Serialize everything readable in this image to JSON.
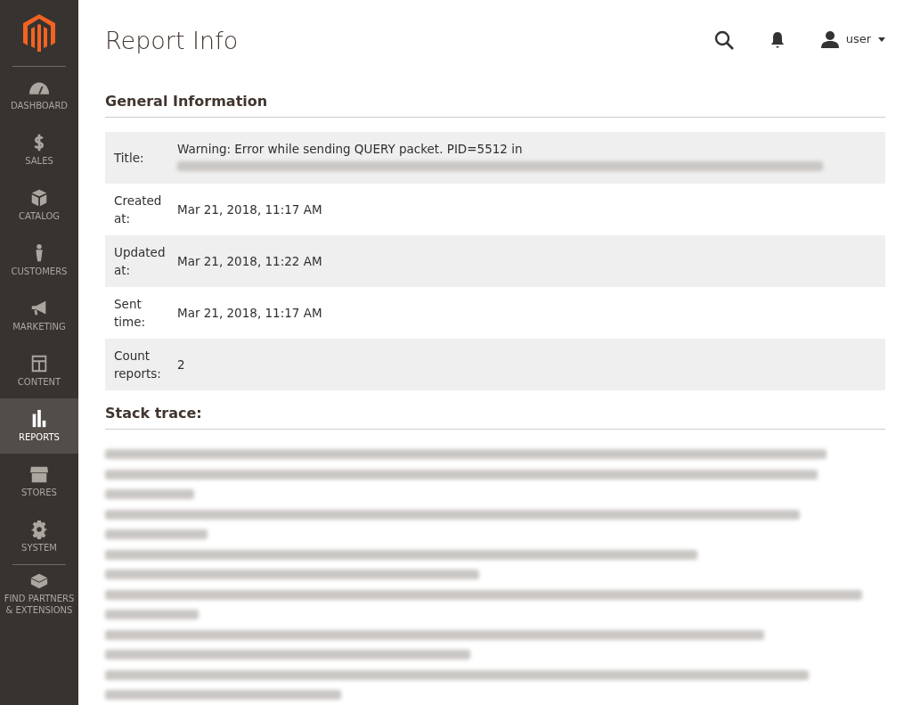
{
  "sidebar": {
    "items": [
      {
        "label": "DASHBOARD",
        "selected": false
      },
      {
        "label": "SALES",
        "selected": false
      },
      {
        "label": "CATALOG",
        "selected": false
      },
      {
        "label": "CUSTOMERS",
        "selected": false
      },
      {
        "label": "MARKETING",
        "selected": false
      },
      {
        "label": "CONTENT",
        "selected": false
      },
      {
        "label": "REPORTS",
        "selected": true
      },
      {
        "label": "STORES",
        "selected": false
      },
      {
        "label": "SYSTEM",
        "selected": false
      },
      {
        "label": "FIND PARTNERS & EXTENSIONS",
        "selected": false
      }
    ]
  },
  "page_title": "Report Info",
  "header": {
    "user": "user"
  },
  "general": {
    "heading": "General Information",
    "rows": [
      {
        "label": "Title:",
        "value": "Warning: Error while sending QUERY packet. PID=5512 in",
        "redacted": true
      },
      {
        "label": "Created at:",
        "value": "Mar 21, 2018, 11:17 AM",
        "redacted": false
      },
      {
        "label": "Updated at:",
        "value": "Mar 21, 2018, 11:22 AM",
        "redacted": false
      },
      {
        "label": "Sent time:",
        "value": "Mar 21, 2018, 11:17 AM",
        "redacted": false
      },
      {
        "label": "Count reports:",
        "value": "2",
        "redacted": false
      }
    ]
  },
  "stack_trace": {
    "heading": "Stack trace:",
    "entries": [
      {
        "lines": [
          {
            "kind": "redacted"
          }
        ]
      },
      {
        "lines": [
          {
            "kind": "redacted"
          },
          {
            "kind": "redacted"
          }
        ]
      },
      {
        "lines": [
          {
            "kind": "redacted"
          },
          {
            "kind": "redacted"
          }
        ]
      },
      {
        "lines": [
          {
            "kind": "redacted"
          },
          {
            "kind": "redacted"
          }
        ]
      },
      {
        "lines": [
          {
            "kind": "redacted"
          },
          {
            "kind": "redacted"
          }
        ]
      },
      {
        "lines": [
          {
            "kind": "redacted"
          },
          {
            "kind": "redacted"
          }
        ]
      },
      {
        "lines": [
          {
            "kind": "redacted"
          },
          {
            "kind": "redacted"
          }
        ]
      }
    ]
  }
}
